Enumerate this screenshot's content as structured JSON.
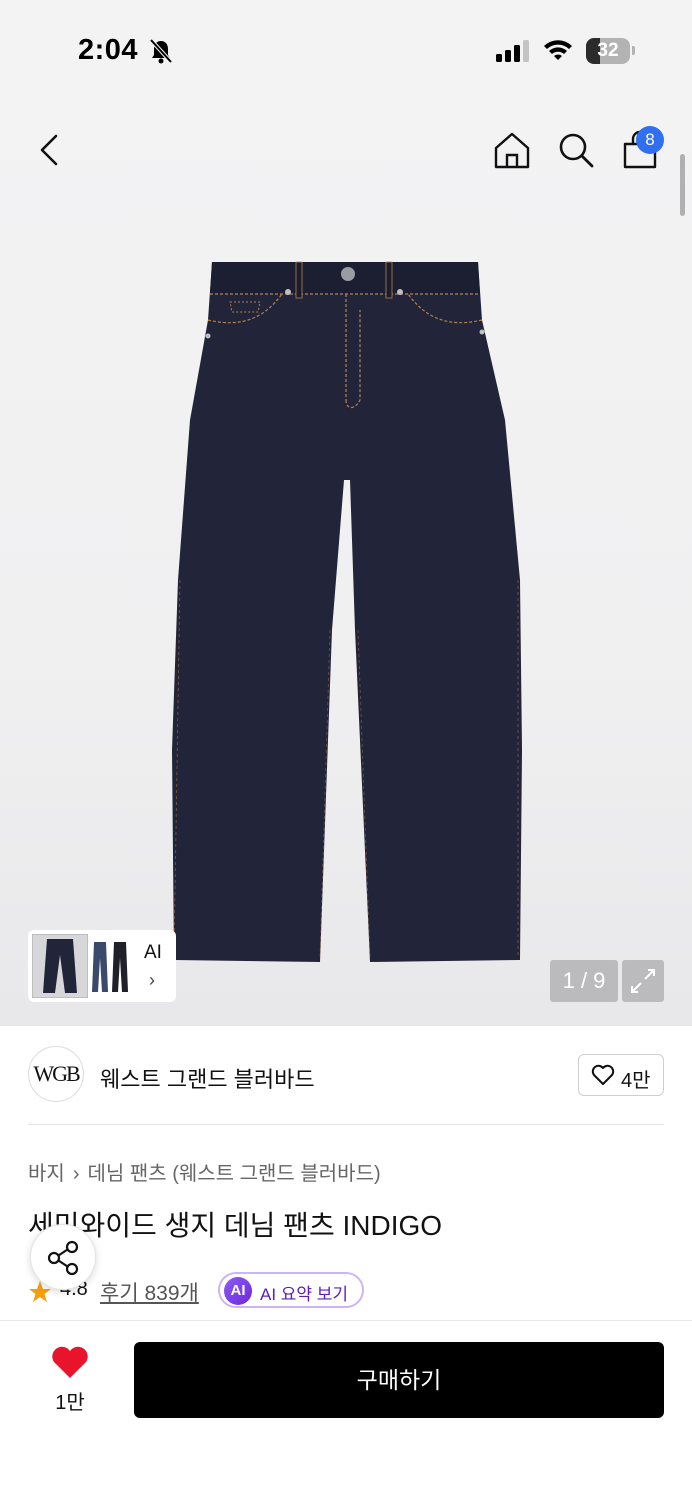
{
  "status_bar": {
    "time": "2:04",
    "battery": "32",
    "battery_level": 0.32,
    "icons": [
      "bell-slash-icon",
      "cellular-signal-icon",
      "wifi-icon",
      "battery-icon"
    ]
  },
  "nav": {
    "icons": [
      "back-chevron-icon",
      "home-icon",
      "search-icon",
      "shopping-bag-icon"
    ],
    "cart_count": "8"
  },
  "gallery": {
    "thumb_ai_label": "AI",
    "thumb_chevron": "›",
    "page_counter": "1 / 9",
    "expand_icon": "expand-icon"
  },
  "brand": {
    "logo_text": "WGB",
    "name": "웨스트 그랜드 블러바드",
    "like_count": "4만"
  },
  "product": {
    "breadcrumb": [
      "바지",
      "데님 팬츠 (웨스트 그랜드 블러바드)"
    ],
    "breadcrumb_sep": "›",
    "title": "세미와이드 생지 데님 팬츠 INDIGO",
    "rating": "4.8",
    "review_link": "후기 839개",
    "ai_badge": "AI",
    "ai_summary": "AI 요약 보기"
  },
  "bottom_bar": {
    "wishlist_count": "1만",
    "buy_label": "구매하기"
  },
  "colors": {
    "denim": "#22253a",
    "stitch": "#b8804a",
    "badge_blue": "#2f6ff0",
    "heart_red": "#e8142c",
    "star_orange": "#f59e0b",
    "ai_purple": "#7c3aed"
  }
}
